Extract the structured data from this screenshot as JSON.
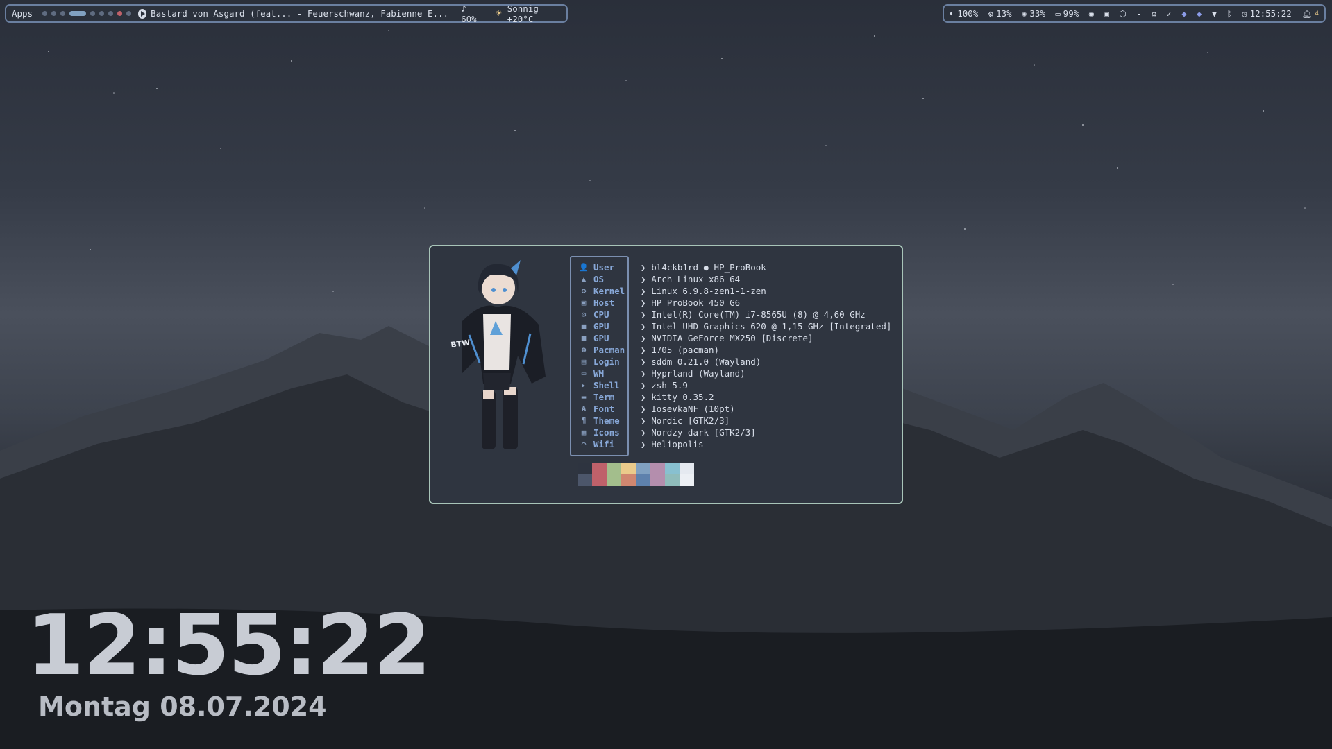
{
  "topbar": {
    "apps_label": "Apps",
    "workspaces": [
      {
        "state": "normal"
      },
      {
        "state": "normal"
      },
      {
        "state": "normal"
      },
      {
        "state": "active"
      },
      {
        "state": "normal"
      },
      {
        "state": "normal"
      },
      {
        "state": "normal"
      },
      {
        "state": "urgent"
      },
      {
        "state": "normal"
      }
    ],
    "media": "Bastard von Asgard (feat... - Feuerschwanz, Fabienne E...",
    "media_volume": "♪ 60%",
    "weather": "Sonnig +20°C",
    "volume": "100%",
    "cpu": "13%",
    "memory": "33%",
    "battery": "99%",
    "dash": "-",
    "time": "12:55:22",
    "notifications": "4"
  },
  "fetch": {
    "labels": [
      {
        "icon": "user-icon",
        "glyph": "👤",
        "text": "User"
      },
      {
        "icon": "arch-icon",
        "glyph": "▲",
        "text": "OS"
      },
      {
        "icon": "gear-icon",
        "glyph": "⚙",
        "text": "Kernel"
      },
      {
        "icon": "host-icon",
        "glyph": "▣",
        "text": "Host"
      },
      {
        "icon": "cpu-icon",
        "glyph": "⚙",
        "text": "CPU"
      },
      {
        "icon": "gpu-icon",
        "glyph": "■",
        "text": "GPU"
      },
      {
        "icon": "gpu-icon",
        "glyph": "■",
        "text": "GPU"
      },
      {
        "icon": "package-icon",
        "glyph": "⊛",
        "text": "Pacman"
      },
      {
        "icon": "login-icon",
        "glyph": "▤",
        "text": "Login"
      },
      {
        "icon": "window-icon",
        "glyph": "▭",
        "text": "WM"
      },
      {
        "icon": "shell-icon",
        "glyph": "▸",
        "text": "Shell"
      },
      {
        "icon": "terminal-icon",
        "glyph": "▬",
        "text": "Term"
      },
      {
        "icon": "font-icon",
        "glyph": "A",
        "text": "Font"
      },
      {
        "icon": "brush-icon",
        "glyph": "¶",
        "text": "Theme"
      },
      {
        "icon": "grid-icon",
        "glyph": "▦",
        "text": "Icons"
      },
      {
        "icon": "wifi-icon",
        "glyph": "◠",
        "text": "Wifi"
      }
    ],
    "values": [
      "bl4ckb1rd ⚉ HP_ProBook",
      "Arch Linux x86_64",
      "Linux 6.9.8-zen1-1-zen",
      "HP ProBook 450 G6",
      "Intel(R) Core(TM) i7-8565U (8) @ 4,60 GHz",
      "Intel UHD Graphics 620 @ 1,15 GHz [Integrated]",
      "NVIDIA GeForce MX250 [Discrete]",
      "1705 (pacman)",
      "sddm 0.21.0 (Wayland)",
      "Hyprland (Wayland)",
      "zsh 5.9",
      "kitty 0.35.2",
      "IosevkaNF (10pt)",
      "Nordic [GTK2/3]",
      "Nordzy-dark [GTK2/3]",
      "Heliopolis"
    ],
    "palette": [
      "#2e3440",
      "#bf616a",
      "#a3be8c",
      "#ebcb8b",
      "#81a1c1",
      "#b48ead",
      "#88c0d0",
      "#e5e9f0",
      "#4c566a",
      "#bf616a",
      "#a3be8c",
      "#d08770",
      "#5e81ac",
      "#b48ead",
      "#8fbcbb",
      "#eceff4"
    ]
  },
  "desktop": {
    "clock": "12:55:22",
    "date": "Montag 08.07.2024"
  }
}
